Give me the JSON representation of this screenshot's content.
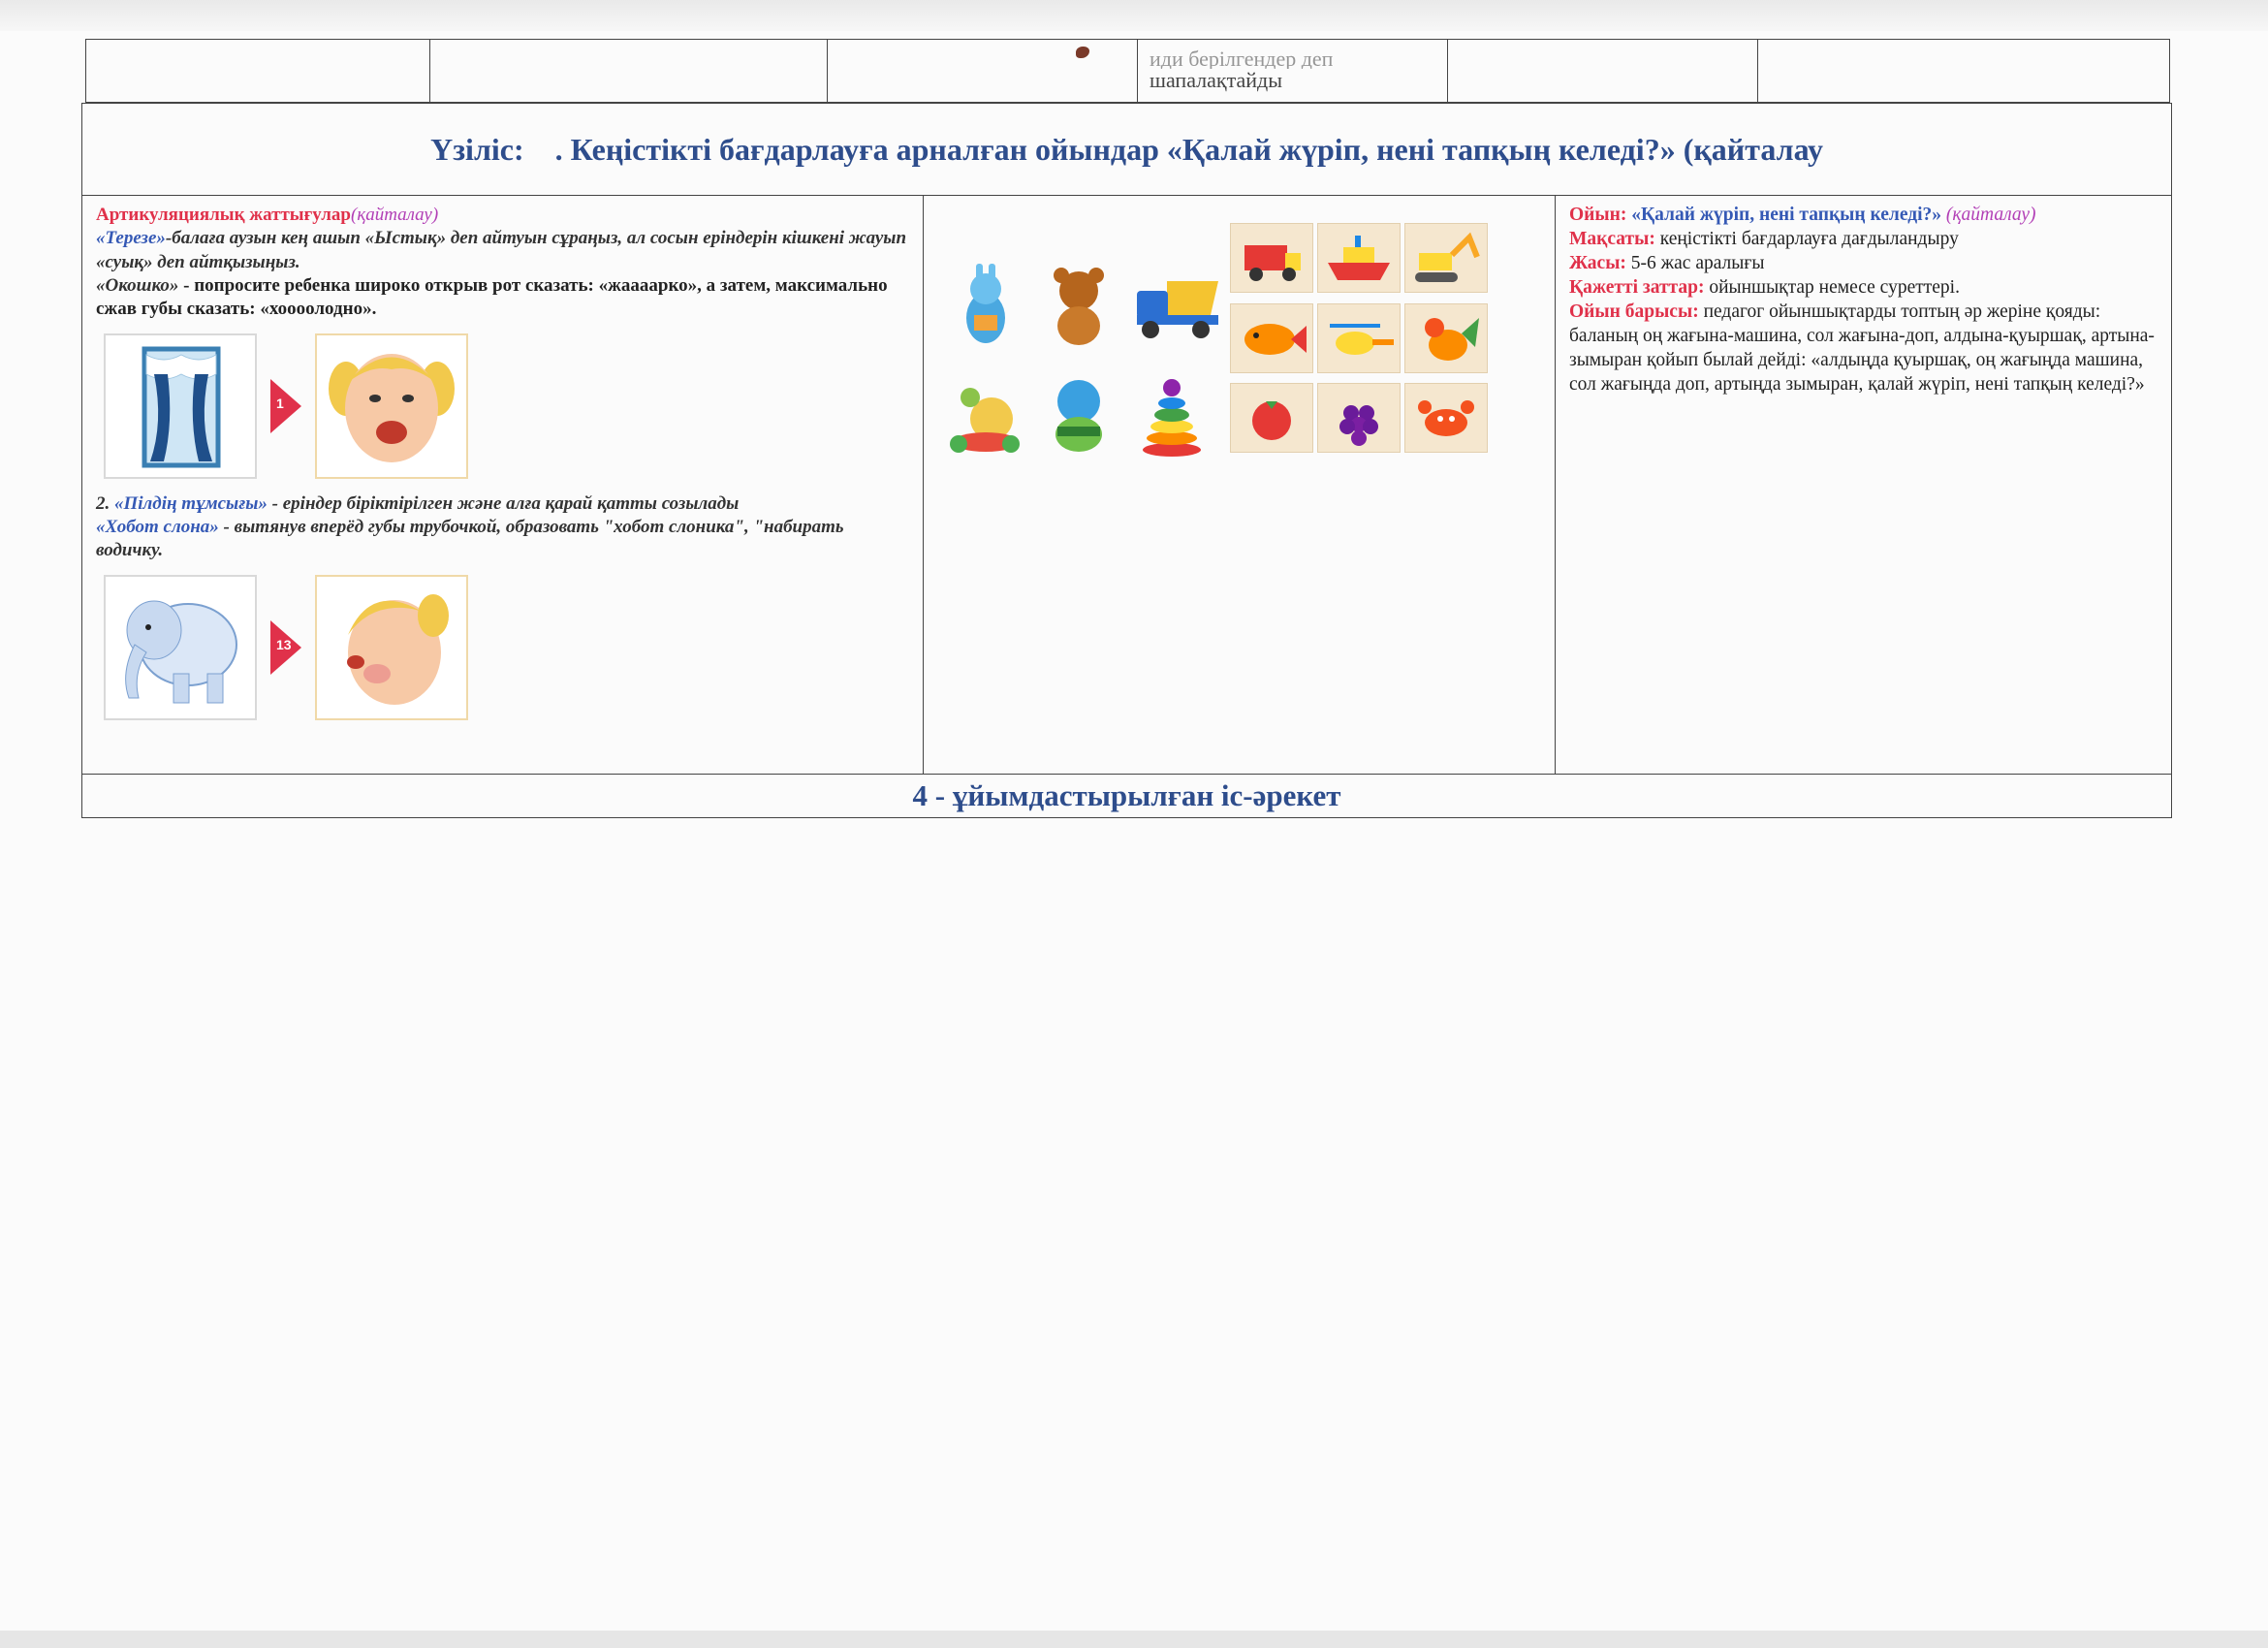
{
  "top_row": {
    "partial_text_cut": "иди берілгендер деп",
    "partial_text": "шапалақтайды"
  },
  "break_row": {
    "label": "Үзіліс:",
    "title": ". Кеңістікті бағдарлауға арналған ойындар «Қалай жүріп, нені тапқың келеді?» (қайталау"
  },
  "left_col": {
    "heading": "Артикуляциялық жаттығулар",
    "heading_tag": "(қайталау)",
    "ex1_name": "«Терезе»",
    "ex1_text": "-балаға аузын кең ашып «Ыстық» деп айтуын сұраңыз, ал сосын еріндерін кішкені жауып «суық» деп айтқызыңыз.",
    "ex1_ru_name": "«Окошко»",
    "ex1_ru_text": " - попросите ребенка широко открыв рот сказать: «жаааарко», а затем, максимально сжав губы сказать: «хоооолодно».",
    "ex1_badge": "1",
    "ex2_prefix": "2. ",
    "ex2_name": "«Пілдің тұмсығы»",
    "ex2_text": " - еріндер біріктірілген және алға қарай қатты созылады",
    "ex2_ru_name": "«Хобот слона»",
    "ex2_ru_text": " - вытянув вперёд губы трубочкой, образовать \"хобот слоника\", \"набирать водичку.",
    "ex2_badge": "13"
  },
  "right_col": {
    "game_label": "Ойын:",
    "game_name": " «Қалай жүріп, нені тапқың келеді?»",
    "game_tag": " (қайталау)",
    "goal_label": "Мақсаты:",
    "goal_text": " кеңістікті бағдарлауға дағдыландыру",
    "age_label": "Жасы:",
    "age_text": " 5-6 жас аралығы",
    "items_label": "Қажетті заттар:",
    "items_text": " ойыншықтар немесе суреттері.",
    "process_label": "Ойын барысы:",
    "process_text": " педагог ойыншықтарды топтың әр жеріне қояды: баланың оң жағына-машина, сол жағына-доп, алдына-қуыршақ, артына-зымыран қойып былай дейді: «алдыңда қуыршақ, оң жағыңда машина, сол жағыңда доп, артыңда зымыран, қалай жүріп, нені тапқың келеді?»"
  },
  "section_row": {
    "title": "4  - ұйымдастырылған іс-әрекет"
  },
  "colors": {
    "red": "#e0314a",
    "purple": "#b23fb6",
    "blue": "#3559b5",
    "title_blue": "#2e4d8c"
  }
}
